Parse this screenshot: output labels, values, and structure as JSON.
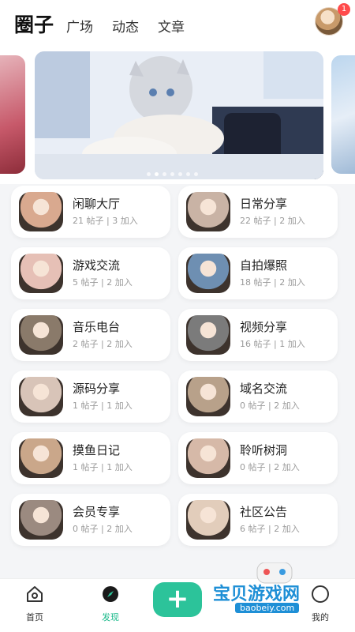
{
  "header": {
    "brand": "圈子",
    "tabs": [
      "广场",
      "动态",
      "文章"
    ],
    "notification_count": "1"
  },
  "carousel": {
    "slide_count": 7,
    "active_index": 1
  },
  "circles": [
    {
      "title": "闲聊大厅",
      "stats": "21 帖子 | 3 加入",
      "color": "#d9a98f"
    },
    {
      "title": "日常分享",
      "stats": "22 帖子 | 2 加入",
      "color": "#c9b3a5"
    },
    {
      "title": "游戏交流",
      "stats": "5 帖子 | 2 加入",
      "color": "#e6c0b6"
    },
    {
      "title": "自拍爆照",
      "stats": "18 帖子 | 2 加入",
      "color": "#6e8fb2"
    },
    {
      "title": "音乐电台",
      "stats": "2 帖子 | 2 加入",
      "color": "#8a7a6a"
    },
    {
      "title": "视频分享",
      "stats": "16 帖子 | 1 加入",
      "color": "#7b7b7b"
    },
    {
      "title": "源码分享",
      "stats": "1 帖子 | 1 加入",
      "color": "#d8c4b8"
    },
    {
      "title": "域名交流",
      "stats": "0 帖子 | 2 加入",
      "color": "#b8a18a"
    },
    {
      "title": "摸鱼日记",
      "stats": "1 帖子 | 1 加入",
      "color": "#caa78a"
    },
    {
      "title": "聆听树洞",
      "stats": "0 帖子 | 2 加入",
      "color": "#d6b9a8"
    },
    {
      "title": "会员专享",
      "stats": "0 帖子 | 2 加入",
      "color": "#9b8a80"
    },
    {
      "title": "社区公告",
      "stats": "6 帖子 | 2 加入",
      "color": "#e2cdbb"
    }
  ],
  "bottom_nav": {
    "home": "首页",
    "discover": "发现",
    "publish_icon": "plus-icon",
    "mine": "我的"
  },
  "watermark": {
    "text": "宝贝游戏网",
    "url": "baobeiy.com"
  },
  "colors": {
    "accent": "#2cc39a",
    "active_label": "#19b98a"
  }
}
